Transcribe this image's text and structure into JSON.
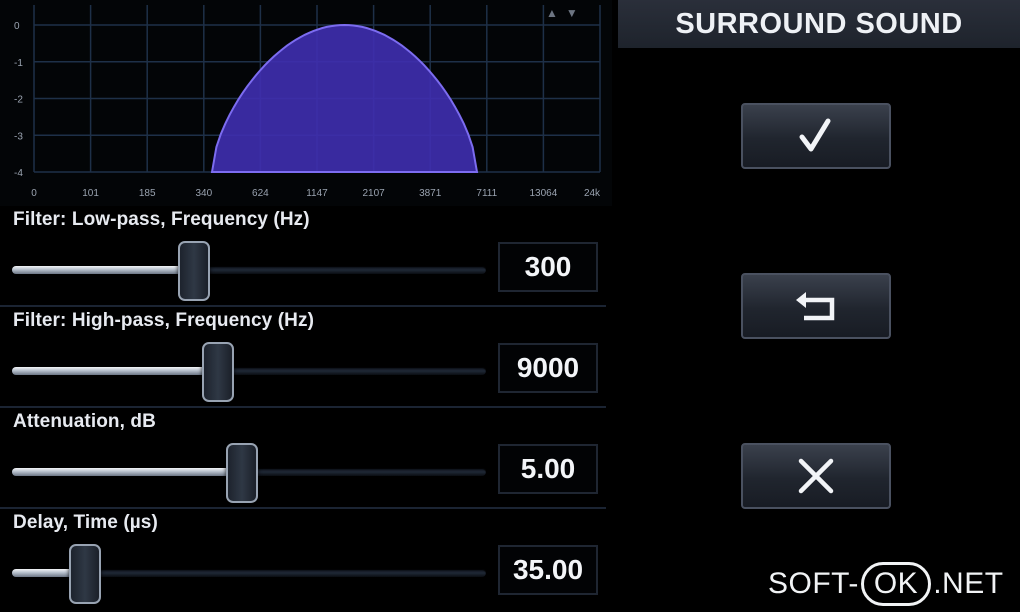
{
  "graph": {
    "y_ticks": [
      "0",
      "-1",
      "-2",
      "-3",
      "-4"
    ],
    "x_ticks": [
      "0",
      "101",
      "185",
      "340",
      "624",
      "1147",
      "2107",
      "3871",
      "7111",
      "13064",
      "24k"
    ],
    "curve_color": "#3f2fb0",
    "curve_edge_color": "#7c6cf0",
    "grid_color": "#1e3048"
  },
  "sliders": [
    {
      "label": "Filter: Low-pass, Frequency (Hz)",
      "value": "300",
      "position": 0.38
    },
    {
      "label": "Filter: High-pass, Frequency (Hz)",
      "value": "9000",
      "position": 0.43
    },
    {
      "label": "Attenuation, dB",
      "value": "5.00",
      "position": 0.48
    },
    {
      "label": "Delay, Time (µs)",
      "value": "35.00",
      "position": 0.15
    }
  ],
  "header": {
    "title": "SURROUND SOUND"
  },
  "actions": {
    "confirm_icon": "check-icon",
    "revert_icon": "undo-icon",
    "cancel_icon": "close-icon"
  },
  "watermark": {
    "prefix": "SOFT-",
    "ok": "OK",
    "suffix": ".NET"
  }
}
